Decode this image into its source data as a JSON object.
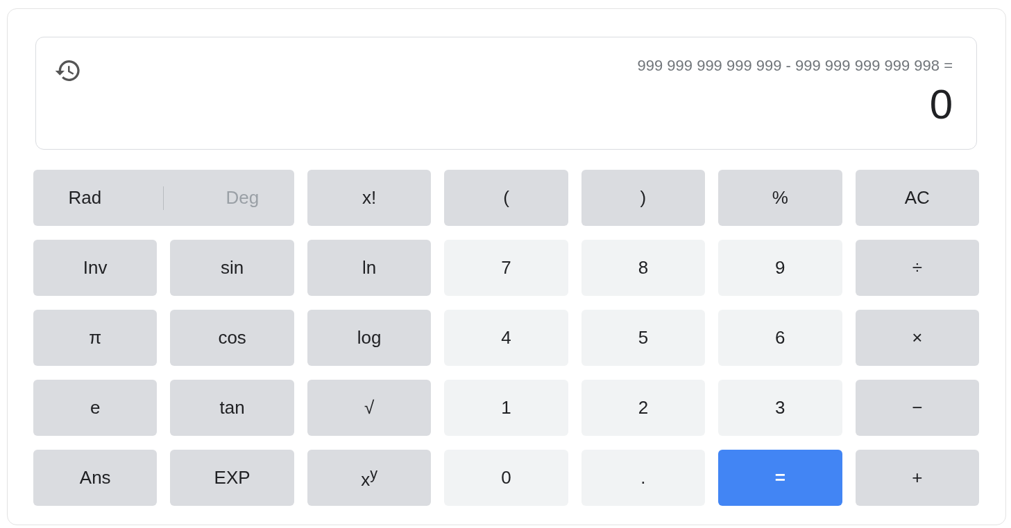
{
  "display": {
    "expression": "999 999 999 999 999 - 999 999 999 999 998 =",
    "result": "0"
  },
  "keys": [
    {
      "kind": "mode",
      "options": [
        {
          "label": "Rad",
          "selected": true
        },
        {
          "label": "Deg",
          "selected": false
        }
      ]
    },
    {
      "kind": "fn",
      "label": "x!"
    },
    {
      "kind": "fn",
      "label": "("
    },
    {
      "kind": "fn",
      "label": ")"
    },
    {
      "kind": "fn",
      "label": "%"
    },
    {
      "kind": "fn",
      "label": "AC"
    },
    {
      "kind": "fn",
      "label": "Inv"
    },
    {
      "kind": "fn",
      "label": "sin"
    },
    {
      "kind": "fn",
      "label": "ln"
    },
    {
      "kind": "num",
      "label": "7"
    },
    {
      "kind": "num",
      "label": "8"
    },
    {
      "kind": "num",
      "label": "9"
    },
    {
      "kind": "fn",
      "label": "÷"
    },
    {
      "kind": "fn",
      "label": "π"
    },
    {
      "kind": "fn",
      "label": "cos"
    },
    {
      "kind": "fn",
      "label": "log"
    },
    {
      "kind": "num",
      "label": "4"
    },
    {
      "kind": "num",
      "label": "5"
    },
    {
      "kind": "num",
      "label": "6"
    },
    {
      "kind": "fn",
      "label": "×"
    },
    {
      "kind": "fn",
      "label": "e"
    },
    {
      "kind": "fn",
      "label": "tan"
    },
    {
      "kind": "fn",
      "label": "√"
    },
    {
      "kind": "num",
      "label": "1"
    },
    {
      "kind": "num",
      "label": "2"
    },
    {
      "kind": "num",
      "label": "3"
    },
    {
      "kind": "fn",
      "label": "−"
    },
    {
      "kind": "fn",
      "label": "Ans"
    },
    {
      "kind": "fn",
      "label": "EXP"
    },
    {
      "kind": "fn",
      "label": "x$^{y}$"
    },
    {
      "kind": "num",
      "label": "0"
    },
    {
      "kind": "num",
      "label": "."
    },
    {
      "kind": "equals",
      "label": "="
    },
    {
      "kind": "fn",
      "label": "+"
    }
  ]
}
